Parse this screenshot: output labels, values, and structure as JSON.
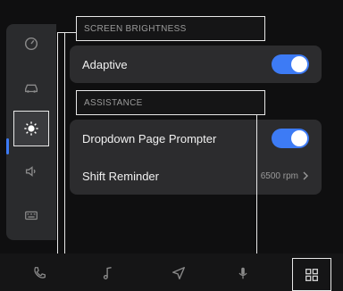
{
  "sidebar": {
    "items": [
      {
        "icon": "speedometer-icon"
      },
      {
        "icon": "car-icon"
      },
      {
        "icon": "brightness-icon",
        "active": true
      },
      {
        "icon": "speaker-icon"
      },
      {
        "icon": "keyboard-icon"
      }
    ],
    "accent": "#3d7bf5"
  },
  "sections": {
    "brightness": {
      "header": "SCREEN BRIGHTNESS",
      "rows": [
        {
          "label": "Adaptive",
          "toggle_on": true
        }
      ]
    },
    "assistance": {
      "header": "ASSISTANCE",
      "rows": [
        {
          "label": "Dropdown Page Prompter",
          "toggle_on": true
        },
        {
          "label": "Shift Reminder",
          "value": "6500 rpm"
        }
      ]
    }
  },
  "dock": {
    "items": [
      "phone-icon",
      "music-icon",
      "navigation-icon",
      "microphone-icon",
      "apps-grid-icon"
    ]
  }
}
